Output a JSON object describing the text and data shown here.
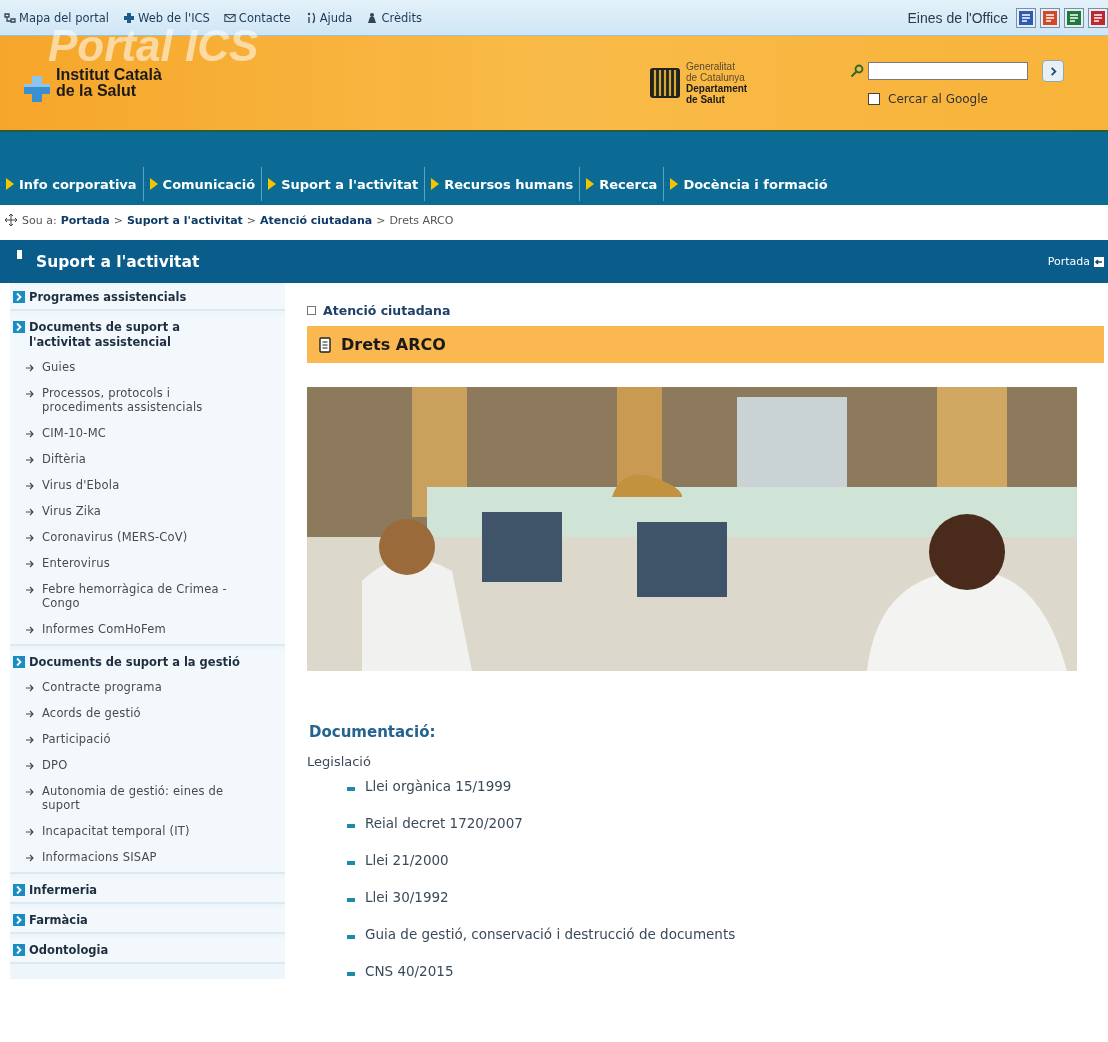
{
  "top_links": [
    {
      "label": "Mapa del portal",
      "kind": "sitemap"
    },
    {
      "label": "Web de l'ICS",
      "kind": "web"
    },
    {
      "label": "Contacte",
      "kind": "mail"
    },
    {
      "label": "Ajuda",
      "kind": "help"
    },
    {
      "label": "Crèdits",
      "kind": "credits"
    }
  ],
  "office_tools": {
    "label": "Eines de l'Office",
    "icons": [
      {
        "kind": "word"
      },
      {
        "kind": "powerpoint"
      },
      {
        "kind": "excel"
      },
      {
        "kind": "pdf"
      }
    ]
  },
  "header": {
    "logo_watermark": "Portal ICS",
    "logo_line_1": "Institut Català",
    "logo_line_2": "de la Salut",
    "gov_lines": [
      "Generalitat",
      "de Catalunya"
    ],
    "gov_dept_lines": [
      "Departament",
      "de Salut"
    ],
    "search": {
      "google_label": "Cercar al Google",
      "google_checked": false
    }
  },
  "nav": [
    "Info corporativa",
    "Comunicació",
    "Suport a l'activitat",
    "Recursos humans",
    "Recerca",
    "Docència i formació"
  ],
  "breadcrumb": {
    "label": "Sou a:",
    "items": [
      {
        "text": "Portada",
        "kind": "link"
      },
      {
        "text": ">",
        "kind": "separator"
      },
      {
        "text": "Suport a l'activitat",
        "kind": "link"
      },
      {
        "text": ">",
        "kind": "separator"
      },
      {
        "text": "Atenció ciutadana",
        "kind": "link"
      },
      {
        "text": ">",
        "kind": "separator"
      },
      {
        "text": "Drets ARCO",
        "kind": "current"
      }
    ]
  },
  "section_bar": {
    "title": "Suport a l'activitat",
    "home_link": "Portada"
  },
  "sidebar": [
    {
      "label": "Programes assistencials"
    },
    {
      "label": "Documents de suport a l'activitat assistencial",
      "children": [
        {
          "label": "Guies"
        },
        {
          "label": "Processos, protocols i procediments assistencials"
        },
        {
          "label": "CIM-10-MC"
        },
        {
          "label": "Diftèria"
        },
        {
          "label": "Virus d'Ebola"
        },
        {
          "label": "Virus Zika"
        },
        {
          "label": "Coronavirus (MERS-CoV)"
        },
        {
          "label": "Enterovirus"
        },
        {
          "label": "Febre hemorràgica de Crimea -Congo"
        },
        {
          "label": "Informes ComHoFem"
        }
      ]
    },
    {
      "label": "Documents de suport a la gestió",
      "children": [
        {
          "label": "Contracte programa"
        },
        {
          "label": "Acords de gestió"
        },
        {
          "label": "Participació"
        },
        {
          "label": "DPO"
        },
        {
          "label": "Autonomia de gestió: eines de suport"
        },
        {
          "label": "Incapacitat temporal (IT)"
        },
        {
          "label": "Informacions SISAP"
        }
      ]
    },
    {
      "label": "Infermeria"
    },
    {
      "label": "Farmàcia"
    },
    {
      "label": "Odontologia"
    }
  ],
  "content": {
    "parent": "Atenció ciutadana",
    "title": "Drets ARCO",
    "photo": {
      "kind": "picture"
    },
    "heading": "Documentació:",
    "subheading": "Legislació",
    "links": [
      "Llei orgànica 15/1999",
      "Reial decret 1720/2007",
      "Llei 21/2000",
      "Llei 30/1992",
      "Guia de gestió, conservació i destrucció de documents",
      "CNS 40/2015"
    ]
  }
}
